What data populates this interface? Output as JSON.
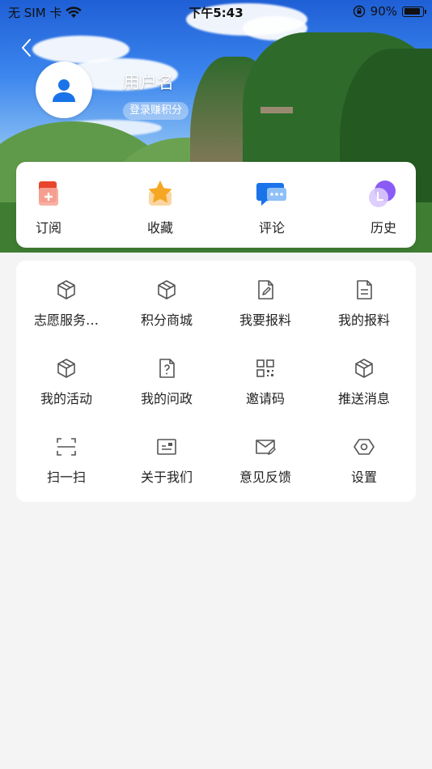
{
  "status_bar": {
    "carrier": "无 SIM 卡",
    "time": "下午5:43",
    "battery": "90%"
  },
  "profile": {
    "username": "用户名",
    "login_hint": "登录赚积分"
  },
  "quick_actions": [
    {
      "label": "订阅",
      "icon": "subscribe-icon"
    },
    {
      "label": "收藏",
      "icon": "star-icon"
    },
    {
      "label": "评论",
      "icon": "comment-icon"
    },
    {
      "label": "历史",
      "icon": "history-icon"
    }
  ],
  "functions": [
    {
      "label": "志愿服务…",
      "icon": "cube-icon"
    },
    {
      "label": "积分商城",
      "icon": "cube-icon"
    },
    {
      "label": "我要报料",
      "icon": "edit-document-icon"
    },
    {
      "label": "我的报料",
      "icon": "document-icon"
    },
    {
      "label": "我的活动",
      "icon": "cube-icon"
    },
    {
      "label": "我的问政",
      "icon": "question-document-icon"
    },
    {
      "label": "邀请码",
      "icon": "qr-code-icon"
    },
    {
      "label": "推送消息",
      "icon": "cube-icon"
    },
    {
      "label": "扫一扫",
      "icon": "scan-icon"
    },
    {
      "label": "关于我们",
      "icon": "id-card-icon"
    },
    {
      "label": "意见反馈",
      "icon": "feedback-mail-icon"
    },
    {
      "label": "设置",
      "icon": "hexagon-settings-icon"
    }
  ],
  "colors": {
    "accent_blue": "#1a73e8",
    "subscribe_red": "#e8452c",
    "star_orange": "#f5a623",
    "history_purple": "#8a5cf5",
    "icon_gray": "#555555"
  }
}
